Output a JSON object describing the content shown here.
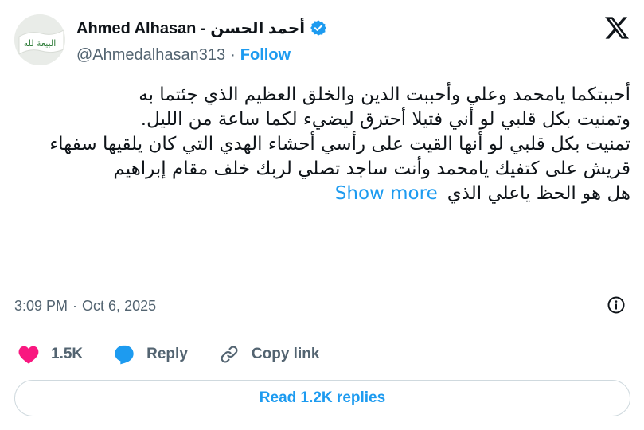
{
  "author": {
    "display_name": "Ahmed Alhasan - أحمد الحسن",
    "handle": "@Ahmedalhasan313",
    "follow_label": "Follow",
    "verified": true,
    "avatar_banner_text": "البيعة لله"
  },
  "tweet": {
    "lines": [
      "أحببتكما يامحمد وعلي وأحببت الدين والخلق العظيم الذي جئتما به",
      "وتمنيت بكل قلبي لو أني فتيلا أحترق ليضيء لكما ساعة من الليل.",
      "تمنيت بكل قلبي لو أنها القيت على رأسي  أحشاء الهدي التي كان يلقيها سفهاء قريش على كتفيك يامحمد وأنت ساجد تصلي لربك خلف مقام إبراهيم",
      "هل هو الحظ ياعلي الذي"
    ],
    "show_more_label": "Show more"
  },
  "meta": {
    "time": "3:09 PM",
    "separator": "·",
    "date": "Oct 6, 2025"
  },
  "actions": {
    "likes_count": "1.5K",
    "reply_label": "Reply",
    "copy_link_label": "Copy link"
  },
  "read_replies_label": "Read 1.2K replies",
  "colors": {
    "accent": "#1d9bf0",
    "like": "#f91880",
    "text": "#0f1419",
    "secondary": "#536471",
    "border": "#cfd9de"
  },
  "icons": [
    "verified-badge-icon",
    "x-logo-icon",
    "info-icon",
    "heart-icon",
    "reply-bubble-icon",
    "link-icon"
  ]
}
